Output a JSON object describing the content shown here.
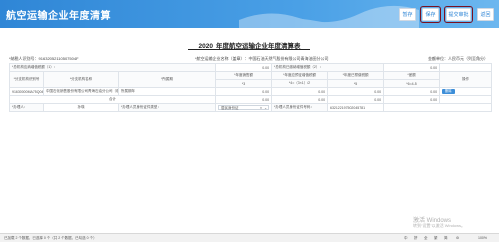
{
  "app": {
    "title": "航空运输企业年度清算"
  },
  "toolbar": {
    "btn1": "暂存",
    "btn2": "保存",
    "btn3": "提交审批",
    "btn4": "返回"
  },
  "document": {
    "year": "2020",
    "title": "年度航空运输企业年度清算表"
  },
  "meta": {
    "taxpayer_id": "*纳税人识别号：91632052110507504F",
    "company": "*航空运输企业名称（盖章）：中国石油天然气股份有限公司青海油田分公司",
    "unit": "金额单位：人民币元（列至角分）"
  },
  "table": {
    "r1": {
      "label": "*总机构应纳增值税额（1）：",
      "value": "0.00",
      "label2": "*总机构已缴纳增值税额（2）：",
      "value2": "0.00"
    },
    "hdr": {
      "c1": "*分支机构识别号",
      "c2": "*分支机构名称",
      "c3": "*所属期",
      "c4": "*年度销售额",
      "c5": "*年度应预征增值税额",
      "c6": "*年度已预缴税额",
      "c7": "*差额",
      "c8": "操作"
    },
    "sub": {
      "s4": "*3",
      "s5": "*4=（3×1）/2",
      "s6": "*5",
      "s7": "*6=4-5"
    },
    "row": {
      "id": "91630000MA75Q040",
      "name": "中国石化销售股份有限公司青海石油分公司（临时）",
      "period": "所属期年",
      "v1": "0.00",
      "v2": "0.00",
      "v3": "0.00",
      "v4": "0.00",
      "op": "删除"
    },
    "total": {
      "label": "合计",
      "v1": "0.00",
      "v2": "0.00",
      "v3": "0.00",
      "v4": "0.00"
    },
    "foot": {
      "handler_label": "*办理人：",
      "handler": "孙瑛",
      "id_type_label": "*办理人员身份证件类型：",
      "id_type": "居民身份证",
      "id_no_label": "*办理人员身份证件号码：",
      "id_no": "632122197502045781"
    }
  },
  "watermark": {
    "line1": "激活 Windows",
    "line2": "转到“设置”以激活 Windows。"
  },
  "taskbar": {
    "left": "已加载 2 个数据，已选择 0 个（共 2 个数据，已勾选 0 个）",
    "zoom": "100%",
    "items": [
      "中",
      "拼",
      "全",
      "繁",
      "简",
      "⚙"
    ]
  },
  "colors": {
    "header": "#2f86d6",
    "accent": "#3d8ed8",
    "highlight": "#7a1020"
  }
}
